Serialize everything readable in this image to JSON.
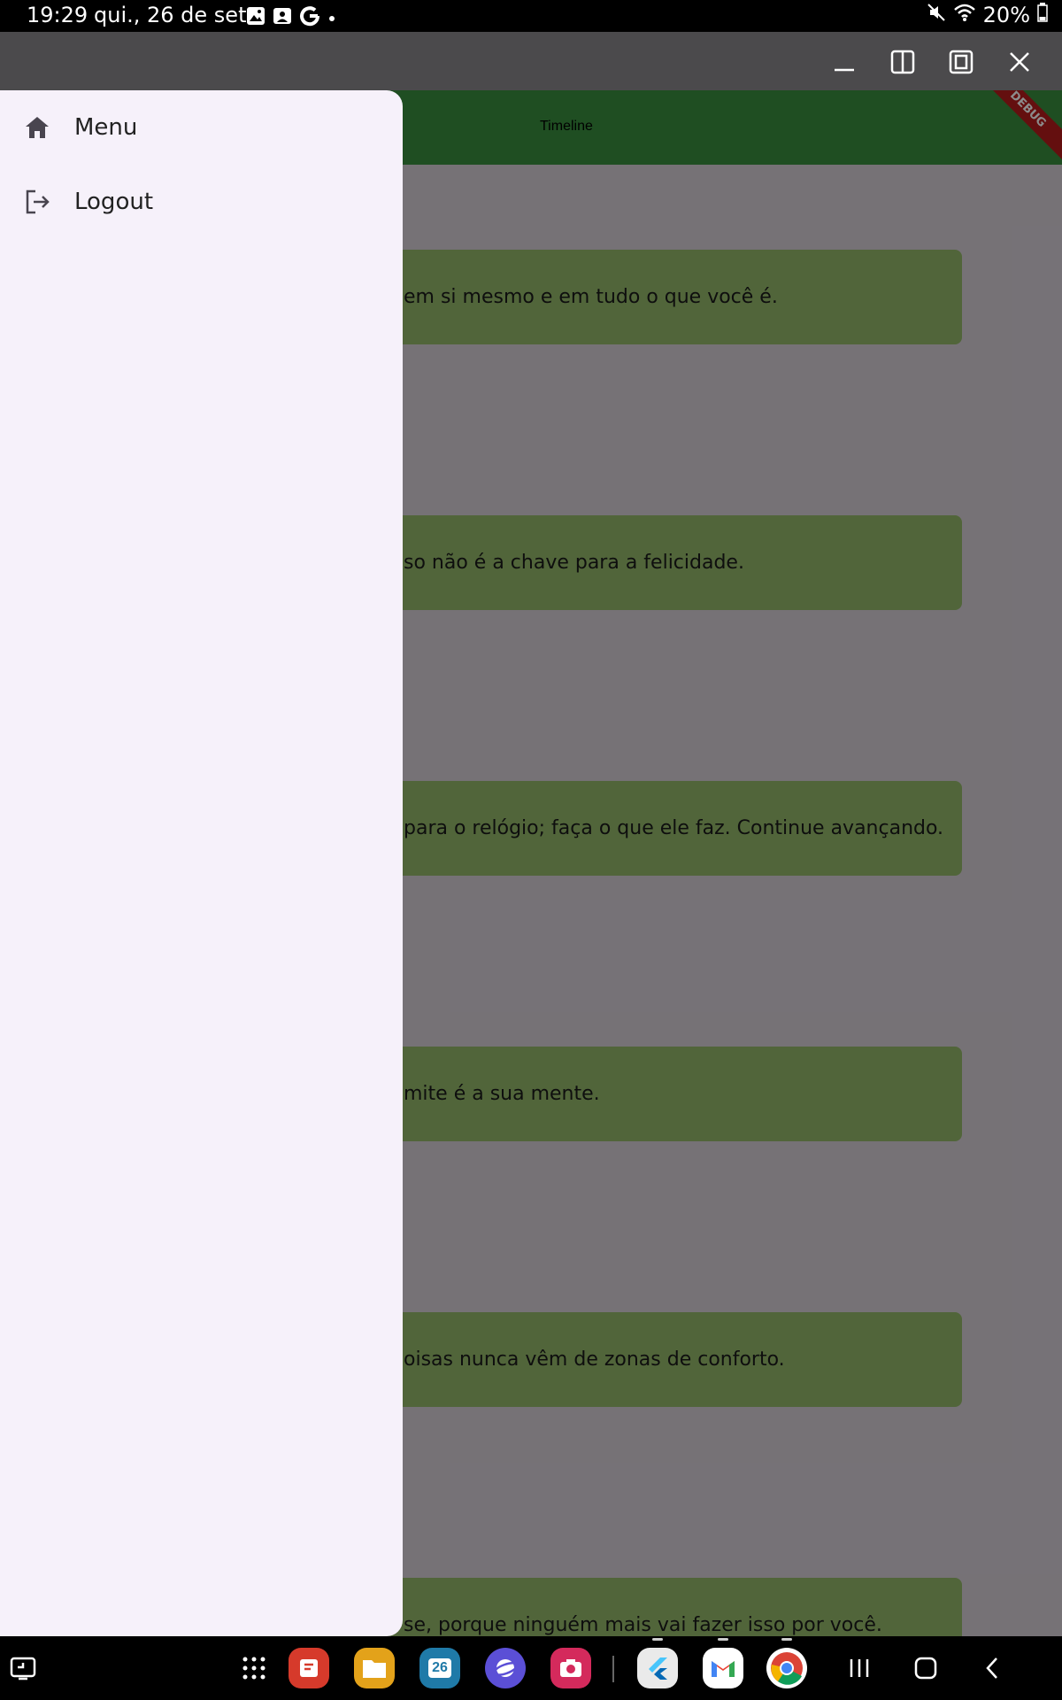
{
  "status_bar": {
    "time": "19:29",
    "date": "qui., 26 de set.",
    "battery": "20%"
  },
  "app": {
    "title": "Timeline",
    "debug_label": "DEBUG",
    "accent_color": "#3a8e3e",
    "card_color": "#94b96a"
  },
  "quotes": [
    "em si mesmo e em tudo o que você é.",
    "so não é a chave para a felicidade.",
    "para o relógio; faça o que ele faz. Continue avançando.",
    "mite é a sua mente.",
    "oisas nunca vêm de zonas de conforto.",
    "se, porque ninguém mais vai fazer isso por você."
  ],
  "drawer": {
    "items": [
      {
        "label": "Menu",
        "icon": "home-icon"
      },
      {
        "label": "Logout",
        "icon": "logout-icon"
      }
    ]
  },
  "taskbar": {
    "apps": [
      "apps-grid",
      "notes",
      "files",
      "calendar",
      "internet",
      "camera",
      "flutter",
      "gmail",
      "chrome"
    ],
    "calendar_day": "26"
  }
}
